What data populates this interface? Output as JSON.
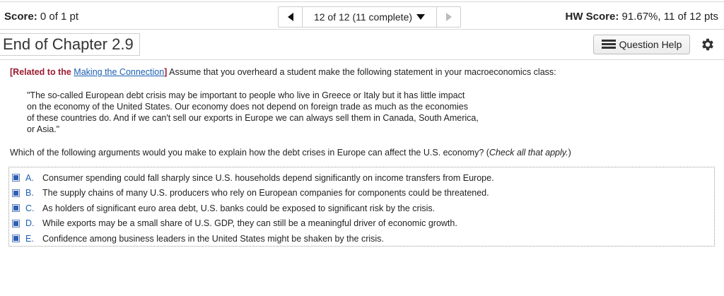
{
  "header": {
    "score_label": "Score:",
    "score_value": "0 of 1 pt",
    "nav_text": "12 of 12 (11 complete)",
    "hw_label": "HW Score:",
    "hw_value": "91.67%, 11 of 12 pts"
  },
  "titlebar": {
    "chapter_title": "End of Chapter 2.9",
    "question_help_label": "Question Help"
  },
  "question": {
    "related_prefix": "[Related to the ",
    "related_link": "Making the Connection",
    "related_suffix": "]",
    "intro": "Assume that you overheard a student make the following statement in your macroeconomics class:",
    "quote_lines": [
      "\"The so-called European debt crisis may be important to people who live in Greece or Italy but it has little impact",
      "on the economy of the United States. Our economy does not depend on foreign trade as much as the economies",
      "of these countries do. And if we can't sell our exports in Europe we can always sell them in Canada, South America,",
      "or Asia.\""
    ],
    "prompt": "Which of the following arguments would you make to explain how the debt crises in Europe can affect the U.S. economy? (",
    "prompt_italic": "Check all that apply.",
    "prompt_end": ")"
  },
  "choices": [
    {
      "letter": "A.",
      "text": "Consumer spending could fall sharply since U.S. households depend significantly on income transfers from Europe."
    },
    {
      "letter": "B.",
      "text": "The supply chains of many U.S. producers who rely on European companies for components could be threatened."
    },
    {
      "letter": "C.",
      "text": "As holders of significant euro area debt, U.S. banks could be exposed to significant risk by the crisis."
    },
    {
      "letter": "D.",
      "text": "While exports may be a small share of U.S. GDP, they can still be a meaningful driver of economic growth."
    },
    {
      "letter": "E.",
      "text": "Confidence among business leaders in the United States might be shaken by the crisis."
    }
  ]
}
